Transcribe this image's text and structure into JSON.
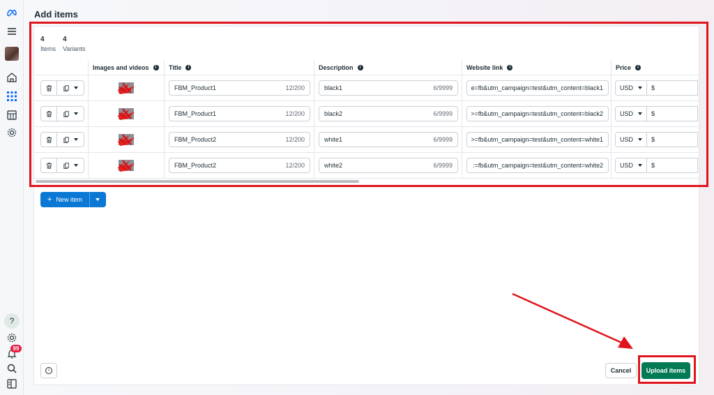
{
  "page": {
    "title": "Add items"
  },
  "counts": [
    {
      "value": "4",
      "label": "Items"
    },
    {
      "value": "4",
      "label": "Variants"
    }
  ],
  "columns": {
    "images": "Images and videos",
    "title": "Title",
    "description": "Description",
    "link": "Website link",
    "price": "Price"
  },
  "rows": [
    {
      "title": "FBM_Product1",
      "title_count": "12/200",
      "description": "black1",
      "desc_count": "6/9999",
      "link": "e=fb&utm_campaign=test&utm_content=black1",
      "currency": "USD",
      "amount": "$"
    },
    {
      "title": "FBM_Product1",
      "title_count": "12/200",
      "description": "black2",
      "desc_count": "6/9999",
      "link": ">=fb&utm_campaign=test&utm_content=black2",
      "currency": "USD",
      "amount": "$"
    },
    {
      "title": "FBM_Product2",
      "title_count": "12/200",
      "description": "white1",
      "desc_count": "6/9999",
      "link": ">=fb&utm_campaign=test&utm_content=white1",
      "currency": "USD",
      "amount": "$"
    },
    {
      "title": "FBM_Product2",
      "title_count": "12/200",
      "description": "white2",
      "desc_count": "6/9999",
      "link": ":=fb&utm_campaign=test&utm_content=white2",
      "currency": "USD",
      "amount": "$"
    }
  ],
  "actions": {
    "new_item": "New item",
    "cancel": "Cancel",
    "upload": "Upload items"
  },
  "rail": {
    "notification_count": "99",
    "help": "?"
  },
  "colors": {
    "upload_green": "#037a56",
    "new_item_blue": "#0a78d4",
    "annotation_red": "#e0141c"
  }
}
